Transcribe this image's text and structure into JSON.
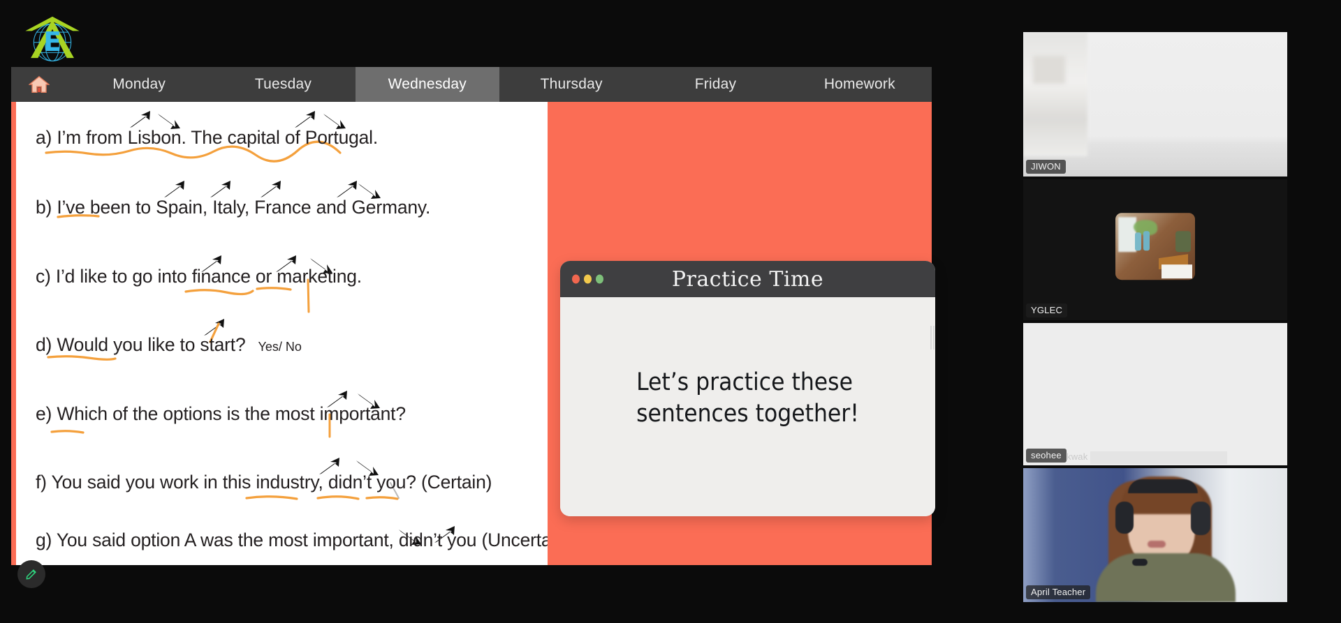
{
  "logo": {
    "name": "e-globe-logo",
    "letter": "E"
  },
  "tabs": [
    {
      "id": "home",
      "label": "Home",
      "icon": "home-icon",
      "active": false
    },
    {
      "id": "monday",
      "label": "Monday",
      "active": false
    },
    {
      "id": "tuesday",
      "label": "Tuesday",
      "active": false
    },
    {
      "id": "wednesday",
      "label": "Wednesday",
      "active": true
    },
    {
      "id": "thursday",
      "label": "Thursday",
      "active": false
    },
    {
      "id": "friday",
      "label": "Friday",
      "active": false
    },
    {
      "id": "homework",
      "label": "Homework",
      "active": false
    }
  ],
  "worksheet": {
    "lines": [
      {
        "id": "a",
        "text": "a) I’m from Lisbon. The capital of Portugal."
      },
      {
        "id": "b",
        "text": "b) I’ve been to Spain, Italy, France and Germany."
      },
      {
        "id": "c",
        "text": "c) I’d like to go into finance or marketing."
      },
      {
        "id": "d",
        "text": "d) Would you like to start?",
        "suffix": "Yes/ No"
      },
      {
        "id": "e",
        "text": "e) Which of the options is the most important?"
      },
      {
        "id": "f",
        "text": "f) You said you work in this industry, didn’t you? (Certain)"
      },
      {
        "id": "g",
        "text": "g) You said option A was the most important, didn’t you (Uncertain)"
      }
    ]
  },
  "card": {
    "title": "Practice Time",
    "body_line1": "Let’s practice these",
    "body_line2": "sentences together!",
    "dots": [
      "#f2674f",
      "#f2c94c",
      "#7ec07a"
    ]
  },
  "tools": {
    "pen_label": "pen-tool",
    "pen_color": "#2fd67f"
  },
  "participants": [
    {
      "id": "jiwon",
      "name": "JIWON",
      "active": false
    },
    {
      "id": "yglec",
      "name": "YGLEC",
      "active": false
    },
    {
      "id": "seohee",
      "name": "seohee",
      "subname": "kwak",
      "active": false
    },
    {
      "id": "april",
      "name": "April Teacher",
      "active": true
    }
  ],
  "colors": {
    "board_accent": "#fb6d55",
    "tabbar": "#3d3d3d",
    "tab_active": "#6e6e6e",
    "card_header": "#3f3f41",
    "card_body": "#efeeec",
    "annotation": "#f4a03c",
    "active_speaker": "#2fd67f",
    "page_background": "#0b0b0b"
  }
}
